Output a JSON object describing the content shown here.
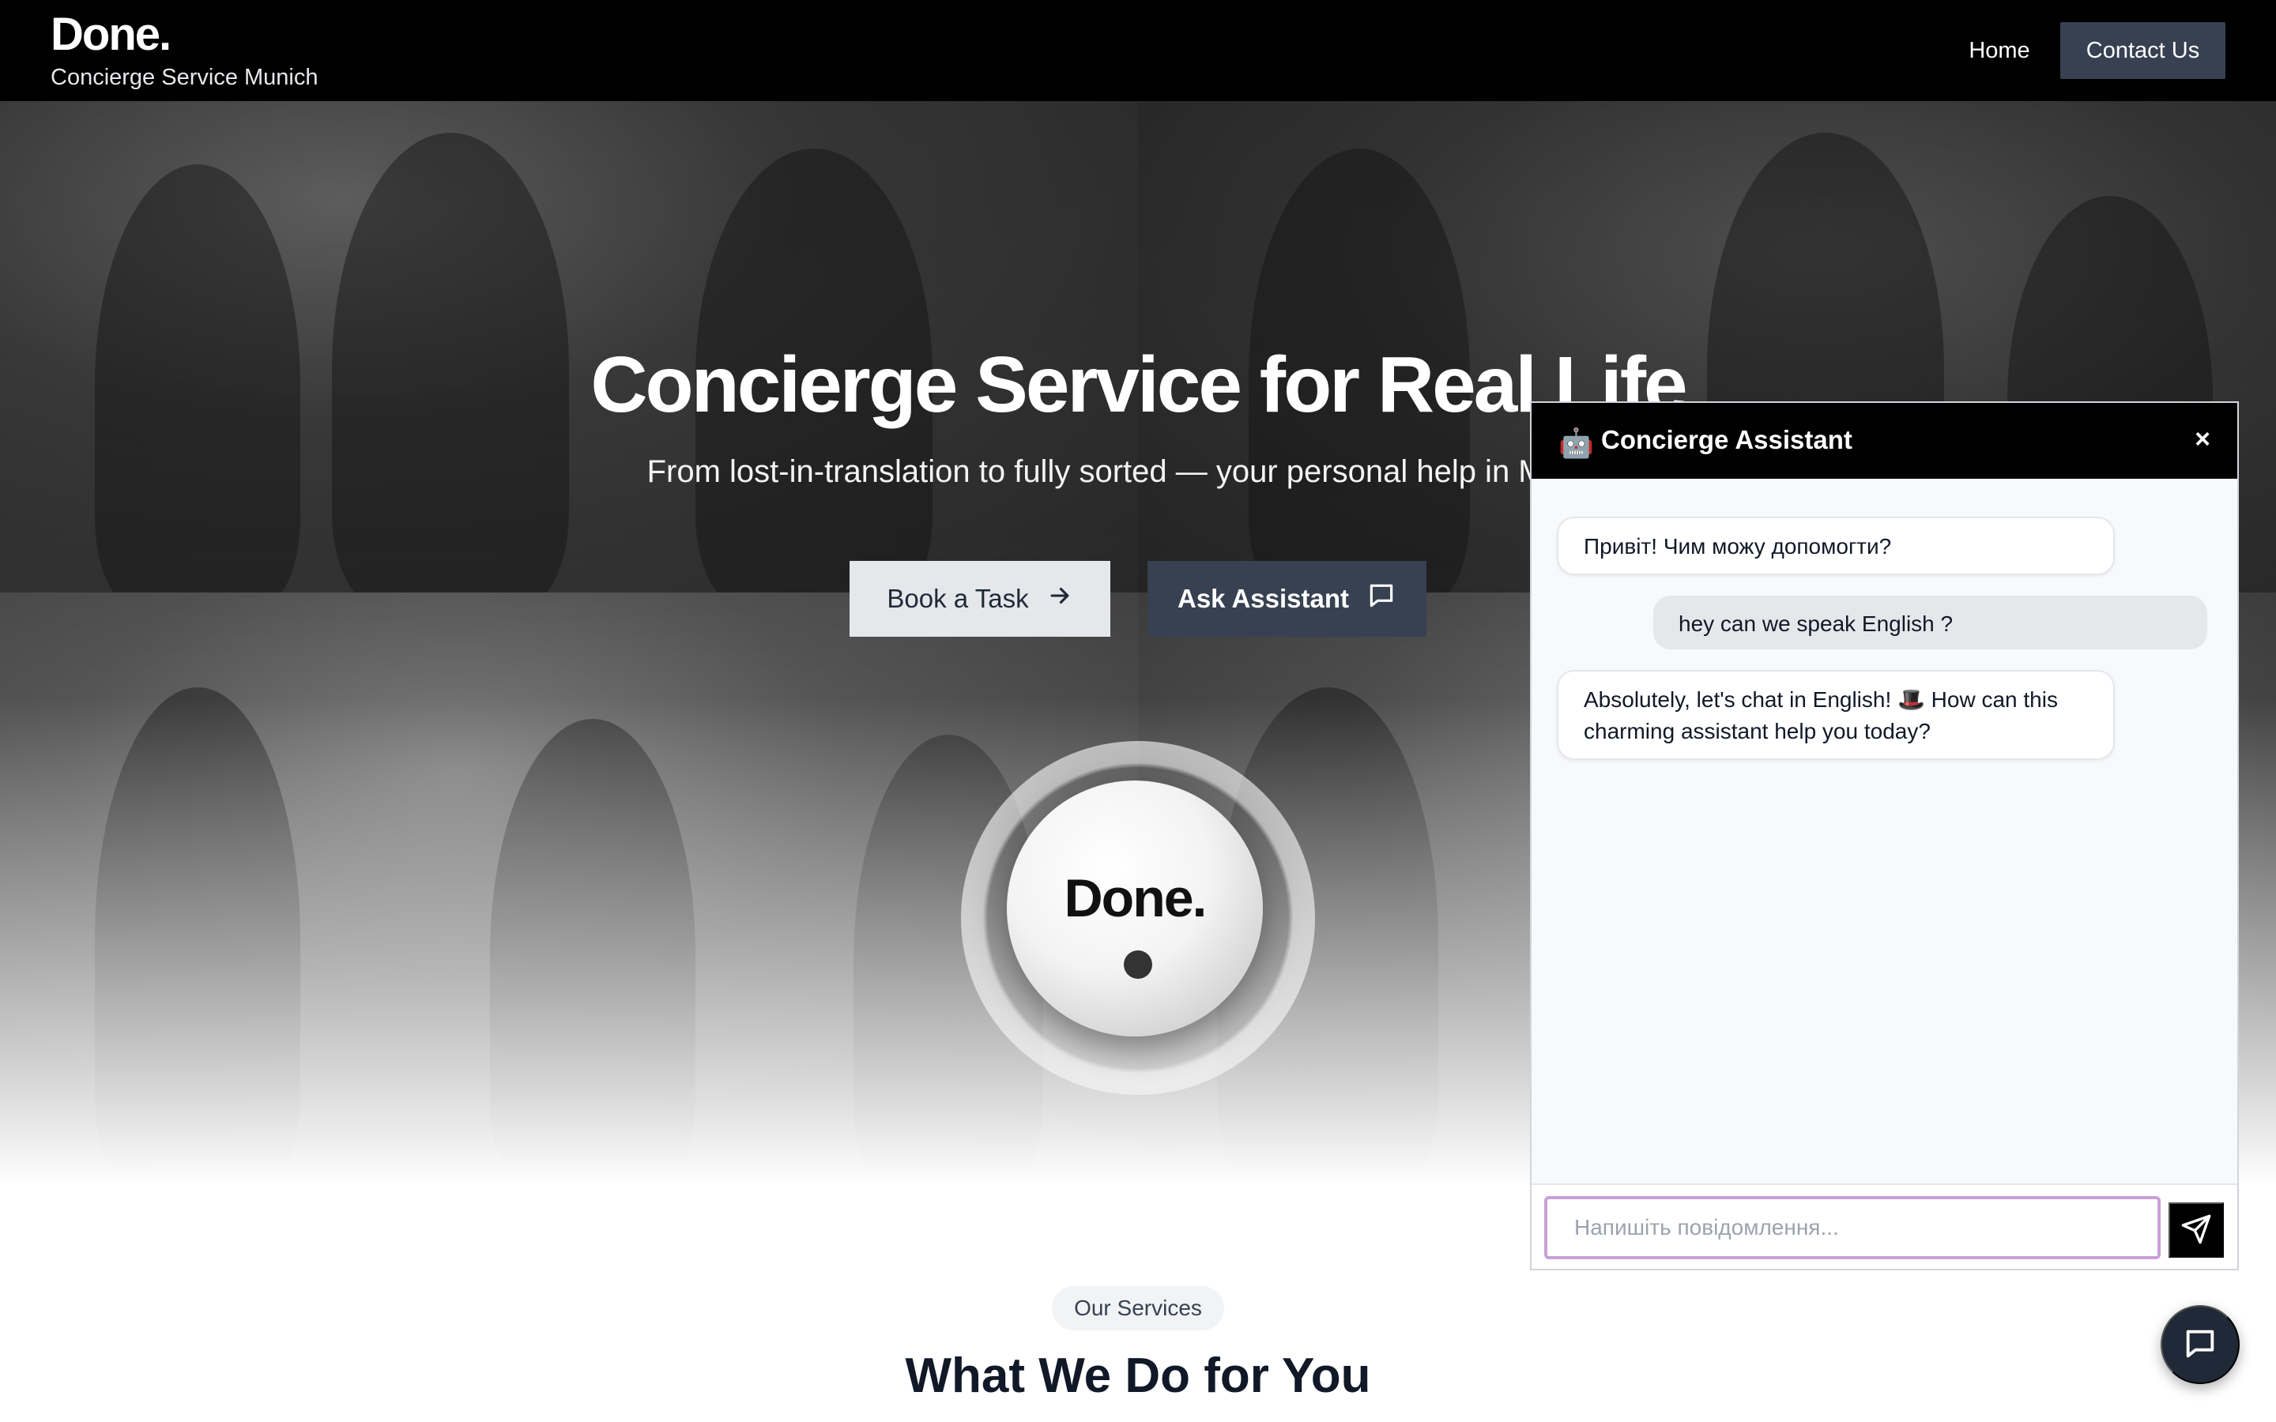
{
  "nav": {
    "brand": "Done.",
    "tagline": "Concierge Service Munich",
    "links": [
      {
        "label": "Home"
      },
      {
        "label": "Contact Us"
      }
    ]
  },
  "hero": {
    "title": "Concierge Service for Real Life",
    "subtitle": "From lost-in-translation to fully sorted — your personal help in Munich.",
    "book_label": "Book a Task",
    "ask_label": "Ask Assistant",
    "orb_text": "Done."
  },
  "services": {
    "pill": "Our Services",
    "title": "What We Do for You"
  },
  "chat": {
    "robot_icon": "🤖",
    "title": "Concierge Assistant",
    "close_symbol": "×",
    "messages": [
      {
        "from": "bot",
        "text": "Привіт! Чим можу допомогти?"
      },
      {
        "from": "user",
        "text": "hey can we speak English ?"
      },
      {
        "from": "bot",
        "text": "Absolutely, let's chat in English! 🎩 How can this charming assistant help you today?"
      }
    ],
    "input_value": "",
    "input_placeholder": "Напишіть повідомлення..."
  },
  "colors": {
    "nav_bg": "#000000",
    "contact_bg": "#374151",
    "ask_bg": "#374151",
    "book_bg": "#e5e7eb",
    "input_focus_border": "#c9a0d9",
    "fab_bg": "#1f2937"
  },
  "icons": {
    "book_button": "arrow-right-icon",
    "ask_button": "chat-bubble-icon",
    "send_button": "send-icon",
    "fab": "chat-bubble-icon"
  }
}
